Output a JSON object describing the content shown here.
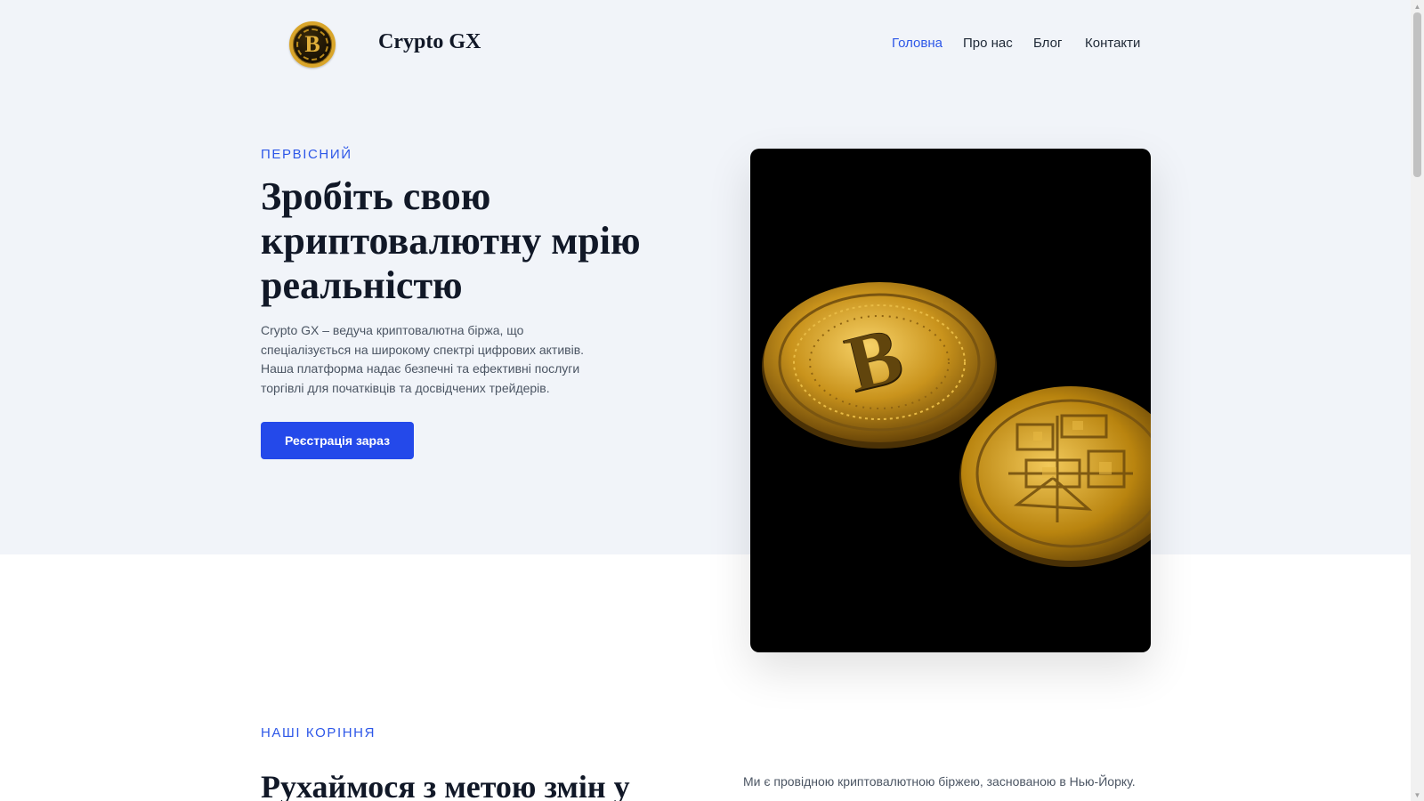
{
  "header": {
    "logo_icon": "bitcoin-coin-icon",
    "logo_glyph": "B",
    "brand": "Crypto GX",
    "nav": [
      {
        "label": "Головна",
        "active": true
      },
      {
        "label": "Про нас",
        "active": false
      },
      {
        "label": "Блог",
        "active": false
      },
      {
        "label": "Контакти",
        "active": false
      }
    ]
  },
  "hero": {
    "eyebrow": "ПЕРВІСНИЙ",
    "title": "Зробіть свою криптовалютну мрію реальністю",
    "text": "Crypto GX – ведуча криптовалютна біржа, що спеціалізується на широкому спектрі цифрових активів. Наша платформа надає безпечні та ефективні послуги торгівлі для початківців та досвідчених трейдерів.",
    "cta_label": "Реєстрація зараз",
    "image_icon": "bitcoin-coins-photo"
  },
  "roots": {
    "eyebrow": "НАШІ КОРІННЯ",
    "title": "Рухаймося з метою змін у",
    "text": "Ми є провідною криптовалютною біржею, заснованою в Нью-Йорку."
  },
  "colors": {
    "accent": "#2d57e8",
    "button": "#2449ea",
    "hero_bg": "#f1f4f9",
    "heading": "#111827",
    "body_text": "#4b5563",
    "gold": "#d9a52a"
  }
}
